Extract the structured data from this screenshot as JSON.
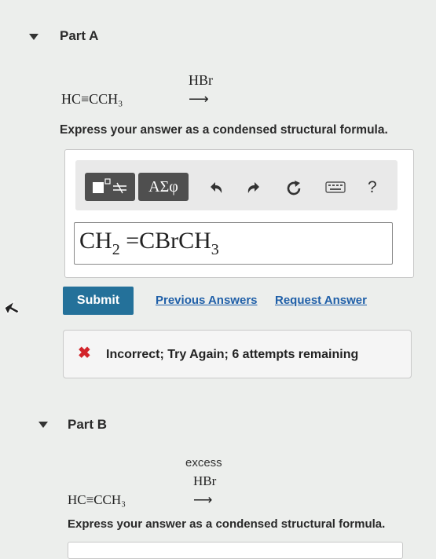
{
  "part_a": {
    "title": "Part A",
    "reactant": "HC≡CCH₃",
    "reagent": "HBr",
    "arrow": "⟶",
    "instruction": "Express your answer as a condensed structural formula."
  },
  "toolbar": {
    "greek_label": "ΑΣφ",
    "help_label": "?",
    "icons": [
      "template-icon",
      "undo-icon",
      "redo-icon",
      "reset-icon",
      "keyboard-icon",
      "help-icon"
    ]
  },
  "answer": {
    "f1": "CH",
    "s1": "2",
    "f2": " =CBrCH",
    "s2": "3"
  },
  "actions": {
    "submit_label": "Submit",
    "previous_label": "Previous Answers",
    "request_label": "Request Answer"
  },
  "feedback": {
    "icon": "✖",
    "message": "Incorrect; Try Again; 6 attempts remaining",
    "color": "#d2232a"
  },
  "part_b": {
    "title": "Part B",
    "reactant": "HC≡CCH₃",
    "reagent_line1": "excess",
    "reagent_line2": "HBr",
    "arrow": "⟶",
    "instruction": "Express your answer as a condensed structural formula."
  },
  "colors": {
    "submit_bg": "#24719a",
    "link": "#1f5fa8",
    "background": "#eceeec"
  }
}
